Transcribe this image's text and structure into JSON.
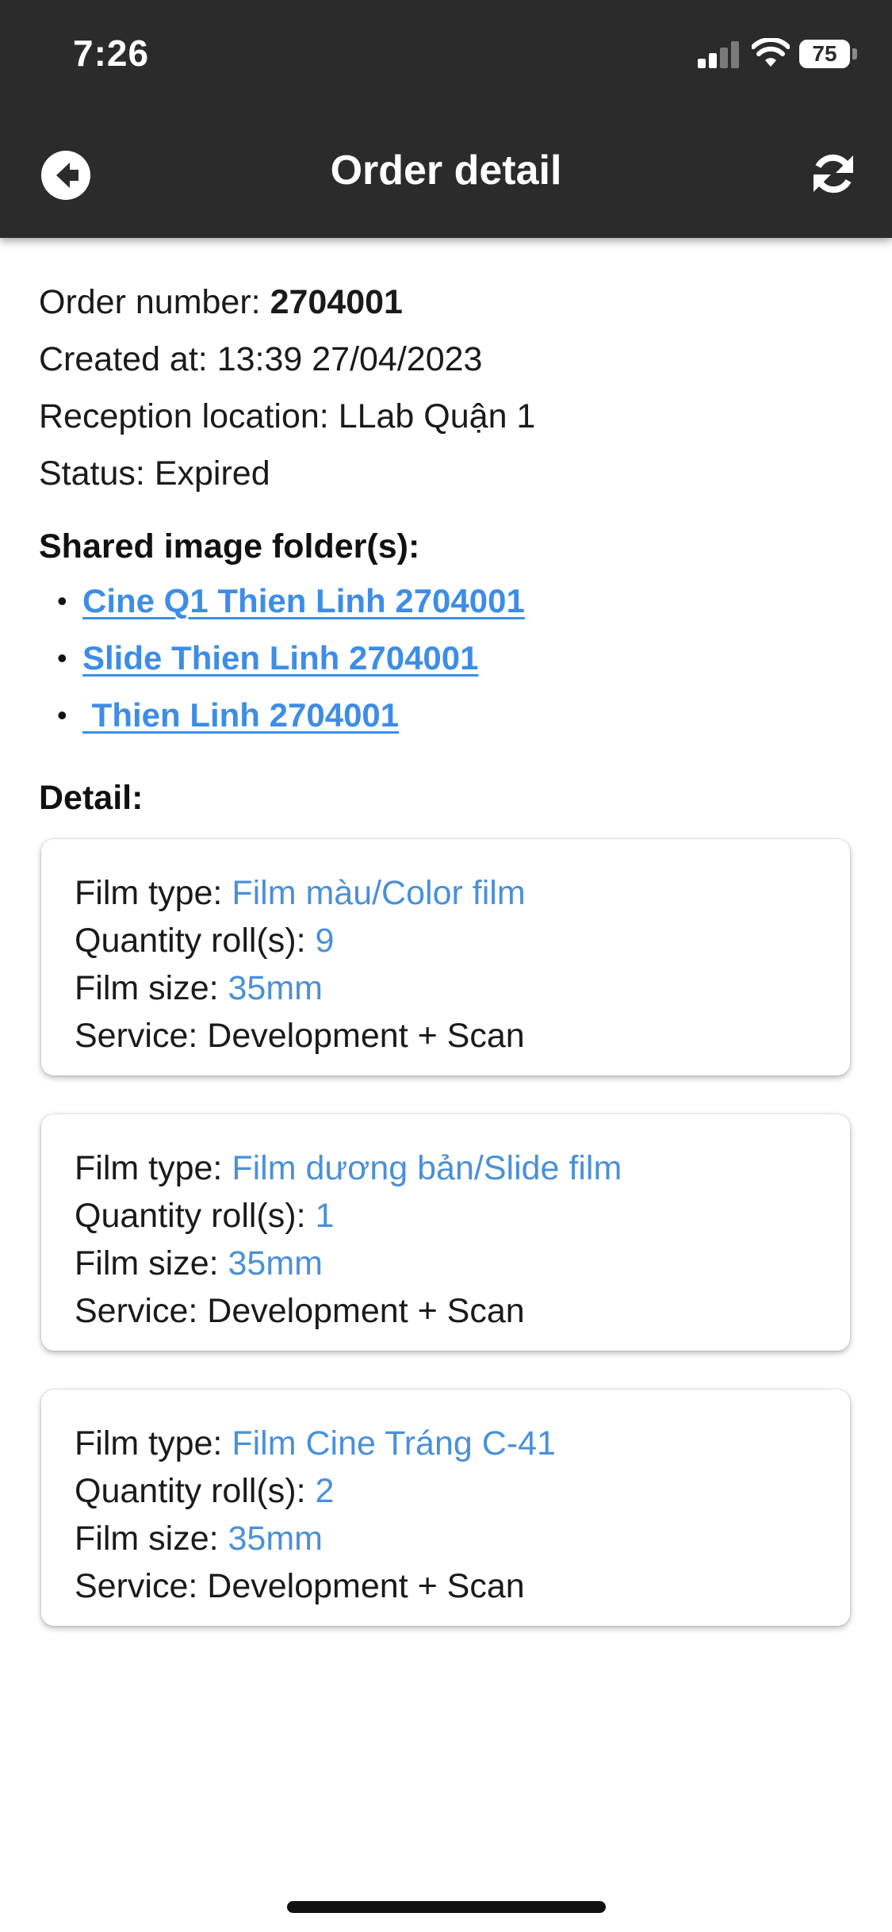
{
  "status_bar": {
    "time": "7:26",
    "battery": "75",
    "battery_level": 0.75
  },
  "header": {
    "title": "Order detail",
    "back_icon": "arrow-left-circle-icon",
    "refresh_icon": "refresh-icon"
  },
  "order": {
    "number_label": "Order number:",
    "number": "2704001",
    "created_label": "Created at:",
    "created": "13:39 27/04/2023",
    "location_label": "Reception location:",
    "location": "LLab Quận 1",
    "status_label": "Status:",
    "status": "Expired"
  },
  "shared": {
    "title": "Shared image folder(s):",
    "folders": [
      "Cine Q1 Thien Linh 2704001",
      "Slide Thien Linh 2704001",
      " Thien Linh 2704001"
    ]
  },
  "detail": {
    "title": "Detail:",
    "labels": {
      "film_type": "Film type:",
      "quantity": "Quantity roll(s):",
      "size": "Film size:",
      "service": "Service:"
    },
    "items": [
      {
        "film_type": "Film màu/Color film",
        "quantity": "9",
        "size": "35mm",
        "service": "Development + Scan"
      },
      {
        "film_type": "Film dương bản/Slide film",
        "quantity": "1",
        "size": "35mm",
        "service": "Development + Scan"
      },
      {
        "film_type": "Film Cine Tráng C-41",
        "quantity": "2",
        "size": "35mm",
        "service": "Development + Scan"
      }
    ]
  },
  "colors": {
    "header_bg": "#2b2b2b",
    "link": "#3d8de6",
    "value": "#4a90d9"
  }
}
